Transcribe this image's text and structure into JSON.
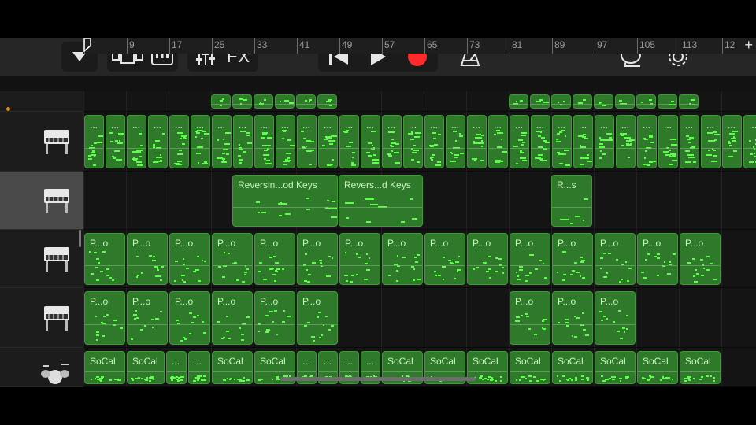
{
  "toolbar": {
    "buttons": [
      {
        "name": "browser-dropdown-button",
        "icon": "chevron-down-icon"
      },
      {
        "name": "tracks-view-button",
        "icon": "tracks-view-icon"
      },
      {
        "name": "keyboard-button",
        "icon": "piano-keys-icon"
      },
      {
        "name": "mixer-button",
        "icon": "sliders-icon"
      },
      {
        "name": "fx-button",
        "label": "FX"
      },
      {
        "name": "rewind-button",
        "icon": "skip-back-icon"
      },
      {
        "name": "play-button",
        "icon": "play-icon"
      },
      {
        "name": "record-button",
        "icon": "record-icon",
        "color": "#ff2b2b"
      },
      {
        "name": "metronome-button",
        "icon": "metronome-icon"
      },
      {
        "name": "loop-browser-button",
        "icon": "lasso-icon"
      },
      {
        "name": "settings-button",
        "icon": "gear-icon"
      }
    ],
    "fx_label": "FX"
  },
  "ruler": {
    "labels": [
      "9",
      "17",
      "25",
      "33",
      "41",
      "49",
      "57",
      "65",
      "73",
      "81",
      "89",
      "97",
      "105",
      "113",
      "12"
    ],
    "add_button": "+"
  },
  "tracks": [
    {
      "instrument": "keyboard-icon",
      "selected": false
    },
    {
      "instrument": "grand-piano-icon",
      "selected": false
    },
    {
      "instrument": "grand-piano-icon",
      "selected": true
    },
    {
      "instrument": "grand-piano-icon",
      "selected": false
    },
    {
      "instrument": "grand-piano-icon",
      "selected": false
    },
    {
      "instrument": "drum-kit-icon",
      "selected": false
    }
  ],
  "regions": {
    "track2": [
      "...",
      "...",
      "...",
      "...",
      "...",
      "...",
      "...",
      "...",
      "...",
      "...",
      "...",
      "...",
      "...",
      "...",
      "...",
      "...",
      "...",
      "...",
      "...",
      "...",
      "...",
      "...",
      "...",
      "...",
      "...",
      "...",
      "...",
      "...",
      "...",
      "...",
      "...",
      "..."
    ],
    "track3": [
      "Reversin...od Keys",
      "Revers...d Keys",
      "R...s"
    ],
    "track4": [
      "P...o",
      "P...o",
      "P...o",
      "P...o",
      "P...o",
      "P...o",
      "P...o",
      "P...o",
      "P...o",
      "P...o",
      "P...o",
      "P...o",
      "P...o",
      "P...o",
      "P...o"
    ],
    "track5": [
      "P...o",
      "P...o",
      "P...o",
      "P...o",
      "P...o",
      "P...o",
      "P...o",
      "P...o",
      "P...o"
    ],
    "track6": [
      "SoCal",
      "SoCal",
      "...",
      "...",
      "SoCal",
      "SoCal",
      "...",
      "...",
      "...",
      "...",
      "SoCal",
      "SoCal",
      "SoCal",
      "SoCal",
      "SoCal",
      "SoCal",
      "SoCal",
      "SoCal"
    ]
  },
  "colors": {
    "region_fill": "#2f7a2a",
    "note": "#5dff4a",
    "record": "#ff2b2b",
    "amber_dot": "#e08a1d"
  }
}
